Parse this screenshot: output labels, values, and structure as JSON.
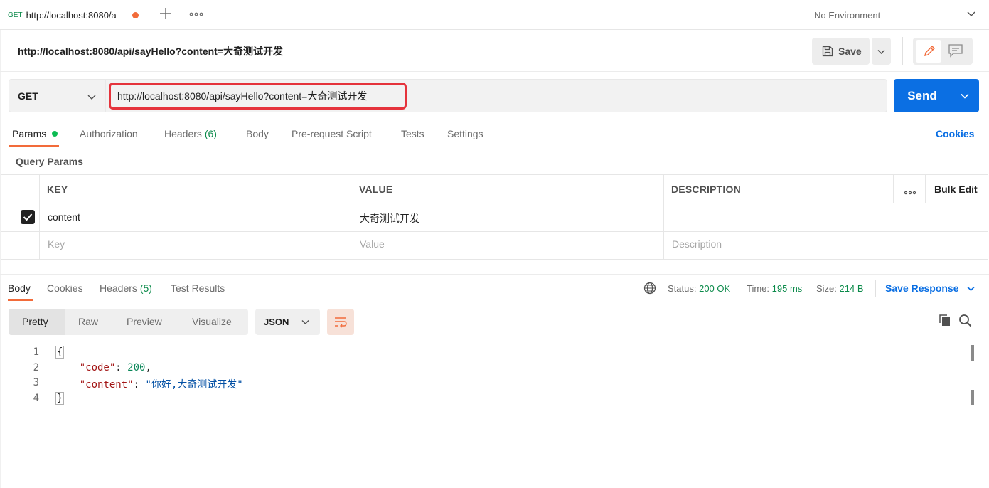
{
  "tab": {
    "method": "GET",
    "url": "http://localhost:8080/a"
  },
  "environment": "No Environment",
  "request": {
    "title": "http://localhost:8080/api/sayHello?content=大奇测试开发",
    "save_label": "Save",
    "method": "GET",
    "url": "http://localhost:8080/api/sayHello?content=大奇测试开发",
    "send_label": "Send"
  },
  "request_tabs": [
    {
      "label": "Params"
    },
    {
      "label": "Authorization"
    },
    {
      "label": "Headers",
      "count": "(6)"
    },
    {
      "label": "Body"
    },
    {
      "label": "Pre-request Script"
    },
    {
      "label": "Tests"
    },
    {
      "label": "Settings"
    }
  ],
  "cookies_link": "Cookies",
  "query_params": {
    "title": "Query Params",
    "headers": [
      "KEY",
      "VALUE",
      "DESCRIPTION"
    ],
    "bulk_edit": "Bulk Edit",
    "rows": [
      {
        "checked": true,
        "key": "content",
        "value": "大奇测试开发",
        "description": ""
      }
    ],
    "placeholders": {
      "key": "Key",
      "value": "Value",
      "description": "Description"
    }
  },
  "response": {
    "tabs": [
      {
        "label": "Body"
      },
      {
        "label": "Cookies"
      },
      {
        "label": "Headers",
        "count": "(5)"
      },
      {
        "label": "Test Results"
      }
    ],
    "status_label": "Status:",
    "status_value": "200 OK",
    "time_label": "Time:",
    "time_value": "195 ms",
    "size_label": "Size:",
    "size_value": "214 B",
    "save_response": "Save Response",
    "views": [
      "Pretty",
      "Raw",
      "Preview",
      "Visualize"
    ],
    "format": "JSON",
    "code": {
      "line_numbers": [
        "1",
        "2",
        "3",
        "4"
      ],
      "open_brace": "{",
      "close_brace": "}",
      "code_key": "\"code\"",
      "code_value": "200",
      "content_key": "\"content\"",
      "content_value": "\"你好,大奇测试开发\""
    }
  },
  "colors": {
    "accent": "#f26b3a",
    "send": "#0b6fe3",
    "highlight": "#e5333c",
    "status_ok": "#0b8a4a"
  }
}
